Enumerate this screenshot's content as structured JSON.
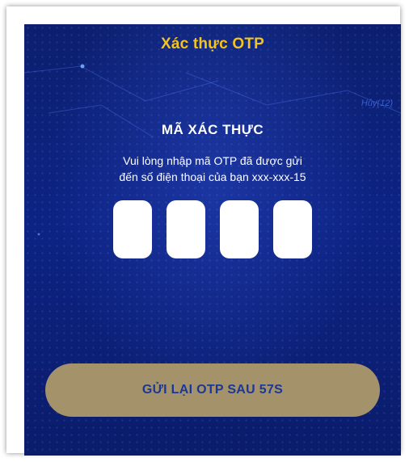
{
  "header": {
    "title": "Xác thực OTP",
    "skip_label": "Hủy(12)"
  },
  "verification": {
    "heading": "MÃ XÁC THỰC",
    "description_line1": "Vui lòng nhập mã OTP đã được gửi",
    "description_line2": "đến số điện thoại của bạn xxx-xxx-15"
  },
  "otp": {
    "digits": [
      "",
      "",
      "",
      ""
    ]
  },
  "resend": {
    "label": "GỬI LẠI OTP SAU 57S"
  },
  "colors": {
    "background": "#0d2384",
    "title": "#f3c41d",
    "button": "#a3926a",
    "button_text": "#1c3795"
  }
}
